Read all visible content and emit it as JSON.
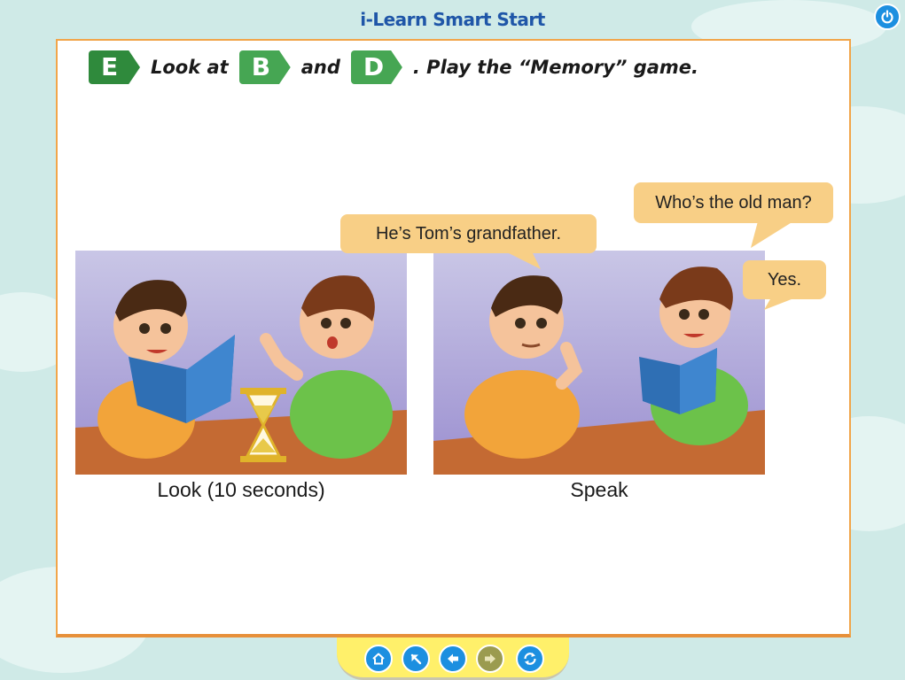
{
  "app": {
    "title": "i-Learn Smart Start"
  },
  "exercise": {
    "letter": "E",
    "text_look_at": "Look at",
    "ref1": "B",
    "text_and": "and",
    "ref2": "D",
    "text_rest": ". Play the “Memory” game."
  },
  "panels": {
    "left": {
      "caption": "Look (10 seconds)"
    },
    "right": {
      "caption": "Speak"
    }
  },
  "bubbles": {
    "grandfather": "He’s Tom’s grandfather.",
    "question": "Who’s the old man?",
    "yes": "Yes."
  },
  "colors": {
    "accent_blue": "#1c8fe0",
    "tag_green": "#2f8a3c",
    "page_border": "#f1a54a",
    "bubble": "#f8cf86",
    "nav_bar": "#fff06a"
  },
  "nav": [
    {
      "icon": "home-icon",
      "state": "enabled"
    },
    {
      "icon": "arrow-up-left-icon",
      "state": "enabled"
    },
    {
      "icon": "arrow-left-icon",
      "state": "enabled"
    },
    {
      "icon": "arrow-right-icon",
      "state": "disabled"
    },
    {
      "icon": "refresh-icon",
      "state": "enabled"
    }
  ]
}
